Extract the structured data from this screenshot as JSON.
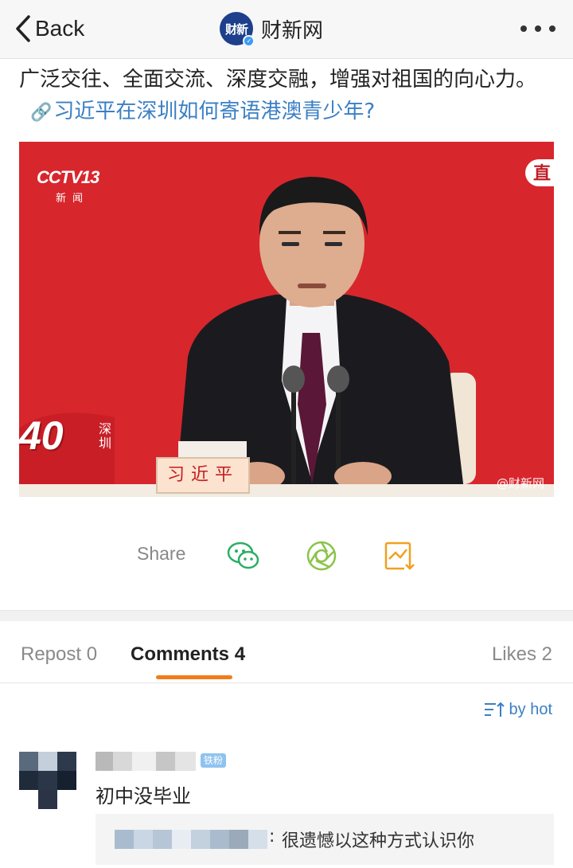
{
  "nav": {
    "back_label": "Back",
    "brand_logo_text": "财新",
    "brand_name": "财新网",
    "more_icon": "more-dots-icon"
  },
  "post": {
    "text": "广泛交往、全面交流、深度交融，增强对祖国的向心力。",
    "link_icon": "🔗",
    "link_text": "习近平在深圳如何寄语港澳青少年?"
  },
  "video": {
    "channel_logo": "CCTV13",
    "channel_sub": "新闻",
    "live_corner": "直",
    "anniversary_number": "40",
    "anniversary_city": "深圳",
    "nameplate": "习近平",
    "watermark": "@财新网",
    "colors": {
      "background": "#d8262d",
      "suit": "#1b1b1f",
      "tie": "#5b1737"
    }
  },
  "share": {
    "label": "Share",
    "buttons": [
      "wechat-icon",
      "moments-icon",
      "save-image-icon"
    ],
    "colors": {
      "wechat": "#2aae67",
      "moments": "#8bc34a",
      "save": "#f0a020"
    }
  },
  "tabs": {
    "repost": "Repost 0",
    "comments": "Comments 4",
    "likes": "Likes 2",
    "active": "comments",
    "accent": "#f07d1c"
  },
  "sort": {
    "label": "by hot",
    "icon": "sort-icon"
  },
  "comments": [
    {
      "badge": "铁粉",
      "text": "初中没毕业",
      "reply": {
        "text": "很遗憾以这种方式认识你"
      }
    }
  ]
}
